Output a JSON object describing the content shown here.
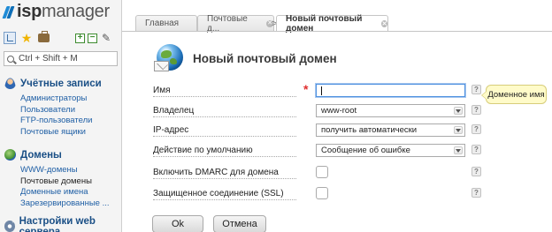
{
  "app": {
    "logo_text_prefix": "isp",
    "logo_text_suffix": "manager"
  },
  "sidebar": {
    "search_placeholder": "Ctrl + Shift + M",
    "groups": [
      {
        "title": "Учётные записи",
        "icon": "users-icon",
        "items": [
          {
            "label": "Администраторы"
          },
          {
            "label": "Пользователи"
          },
          {
            "label": "FTP-пользователи"
          },
          {
            "label": "Почтовые ящики"
          }
        ]
      },
      {
        "title": "Домены",
        "icon": "globe-icon",
        "items": [
          {
            "label": "WWW-домены"
          },
          {
            "label": "Почтовые домены",
            "active": true
          },
          {
            "label": "Доменные имена"
          },
          {
            "label": "Зарезервированные ..."
          }
        ]
      },
      {
        "title": "Настройки web сервера",
        "icon": "gear-icon",
        "items": []
      }
    ]
  },
  "tabs": [
    {
      "label": "Главная",
      "active": false,
      "closable": false
    },
    {
      "label": "Почтовые д...",
      "active": false,
      "closable": true
    },
    {
      "label": "Новый почтовый домен",
      "active": true,
      "closable": true
    }
  ],
  "tab_separator": ">",
  "form": {
    "title": "Новый почтовый домен",
    "fields": [
      {
        "label": "Имя",
        "type": "text",
        "value": "",
        "required": true,
        "focused": true
      },
      {
        "label": "Владелец",
        "type": "select",
        "value": "www-root"
      },
      {
        "label": "IP-адрес",
        "type": "select",
        "value": "получить автоматически"
      },
      {
        "label": "Действие по умолчанию",
        "type": "select",
        "value": "Сообщение об ошибке"
      },
      {
        "label": "Включить DMARC для домена",
        "type": "checkbox",
        "checked": false
      },
      {
        "label": "Защищенное соединение (SSL)",
        "type": "checkbox",
        "checked": false
      }
    ],
    "required_marker": "*",
    "help_glyph": "?",
    "tooltip": "Доменное имя",
    "ok_label": "Ok",
    "cancel_label": "Отмена"
  },
  "colors": {
    "link": "#1f5fa5",
    "group_title": "#1a4f86",
    "required": "#e03030",
    "tooltip_bg": "#fffbc9"
  }
}
